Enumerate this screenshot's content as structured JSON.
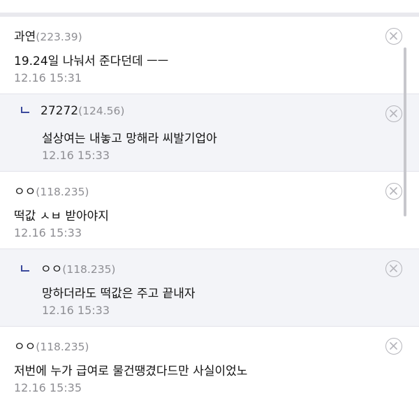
{
  "comments": [
    {
      "author": "과연",
      "ip": "(223.39)",
      "text": "19.24일 나눠서 준다던데 ㅡㅡ",
      "time": "12.16 15:31",
      "reply": false
    },
    {
      "author": "27272",
      "ip": "(124.56)",
      "text": "설상여는 내놓고 망해라 씨발기업아",
      "time": "12.16 15:33",
      "reply": true
    },
    {
      "author": "ㅇㅇ",
      "ip": "(118.235)",
      "text": "떡값 ㅅㅂ 받아야지",
      "time": "12.16 15:33",
      "reply": false
    },
    {
      "author": "ㅇㅇ",
      "ip": "(118.235)",
      "text": "망하더라도 떡값은 주고 끝내자",
      "time": "12.16 15:33",
      "reply": true
    },
    {
      "author": "ㅇㅇ",
      "ip": "(118.235)",
      "text": "저번에 누가 급여로 물건땡겼다드만 사실이었노",
      "time": "12.16 15:35",
      "reply": false
    }
  ],
  "icons": {
    "delete": "close-circle-icon",
    "reply_marker": "reply-arrow-icon"
  },
  "colors": {
    "reply_bg": "#f3f4f8",
    "reply_marker": "#3b4a9c",
    "meta_text": "#8e8e93"
  }
}
